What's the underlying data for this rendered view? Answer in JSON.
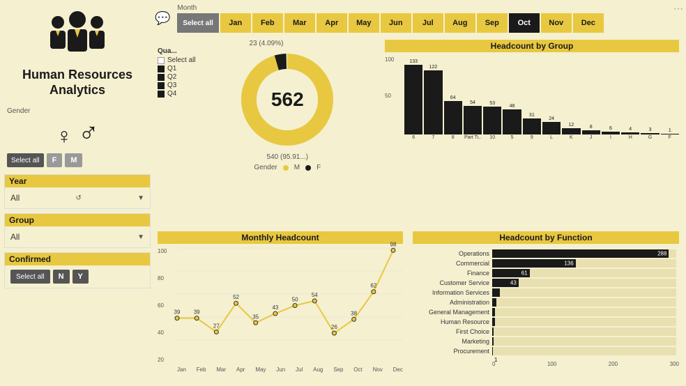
{
  "brand": {
    "title": "Human Resources Analytics"
  },
  "gender": {
    "label": "Gender",
    "select_all": "Select all",
    "f_label": "F",
    "m_label": "M"
  },
  "month_selector": {
    "label": "Month",
    "select_all": "Select all",
    "months": [
      "Jan",
      "Feb",
      "Mar",
      "Apr",
      "May",
      "Jun",
      "Jul",
      "Aug",
      "Sep",
      "Oct",
      "Nov",
      "Dec"
    ],
    "selected": "Oct"
  },
  "quarter": {
    "title": "Qua...",
    "select_all": "Select all",
    "items": [
      "Q1",
      "Q2",
      "Q3",
      "Q4"
    ]
  },
  "donut": {
    "percentage_top": "23 (4.09%)",
    "center_value": "562",
    "bottom_label": "540 (95.91...)",
    "gender_legend": {
      "m_label": "M",
      "f_label": "F"
    }
  },
  "headcount_group": {
    "title": "Headcount by Group",
    "bars": [
      {
        "label": "6",
        "value": 133
      },
      {
        "label": "7",
        "value": 122
      },
      {
        "label": "8",
        "value": 64
      },
      {
        "label": "Part Ti...",
        "value": 54
      },
      {
        "label": "10",
        "value": 53
      },
      {
        "label": "5",
        "value": 48
      },
      {
        "label": "9",
        "value": 31
      },
      {
        "label": "L",
        "value": 24
      },
      {
        "label": "K",
        "value": 12
      },
      {
        "label": "J",
        "value": 8
      },
      {
        "label": "I",
        "value": 6
      },
      {
        "label": "H",
        "value": 4
      },
      {
        "label": "G",
        "value": 3
      },
      {
        "label": "F",
        "value": 1
      }
    ],
    "max": 133,
    "y_labels": [
      "100",
      "50"
    ]
  },
  "monthly_headcount": {
    "title": "Monthly Headcount",
    "points": [
      {
        "label": "Jan",
        "value": 39
      },
      {
        "label": "Feb",
        "value": 39
      },
      {
        "label": "Mar",
        "value": 27
      },
      {
        "label": "Apr",
        "value": 52
      },
      {
        "label": "May",
        "value": 35
      },
      {
        "label": "Jun",
        "value": 43
      },
      {
        "label": "Jul",
        "value": 50
      },
      {
        "label": "Aug",
        "value": 54
      },
      {
        "label": "Sep",
        "value": 26
      },
      {
        "label": "Oct",
        "value": 38
      },
      {
        "label": "Nov",
        "value": 62
      },
      {
        "label": "Dec",
        "value": 98
      }
    ],
    "y_labels": [
      "100",
      "80",
      "60",
      "40",
      "20"
    ],
    "max": 100,
    "min": 20
  },
  "headcount_function": {
    "title": "Headcount by Function",
    "max": 300,
    "x_labels": [
      "0",
      "100",
      "200",
      "300"
    ],
    "rows": [
      {
        "label": "Operations",
        "value": 288,
        "pct": 96
      },
      {
        "label": "Commercial",
        "value": 136,
        "pct": 45
      },
      {
        "label": "Finance",
        "value": 61,
        "pct": 20
      },
      {
        "label": "Customer Service",
        "value": 43,
        "pct": 14
      },
      {
        "label": "Information Services",
        "value": 13,
        "pct": 4
      },
      {
        "label": "Administration",
        "value": 7,
        "pct": 2
      },
      {
        "label": "General Management",
        "value": 5,
        "pct": 2
      },
      {
        "label": "Human Resource",
        "value": 5,
        "pct": 2
      },
      {
        "label": "First Choice",
        "value": 2,
        "pct": 1
      },
      {
        "label": "Marketing",
        "value": 2,
        "pct": 1
      },
      {
        "label": "Procurement",
        "value": 1,
        "pct": 0
      }
    ]
  },
  "year_filter": {
    "label": "Year",
    "value": "All"
  },
  "group_filter": {
    "label": "Group",
    "value": "All"
  },
  "confirmed_filter": {
    "label": "Confirmed",
    "select_all": "Select all",
    "n_label": "N",
    "y_label": "Y"
  }
}
